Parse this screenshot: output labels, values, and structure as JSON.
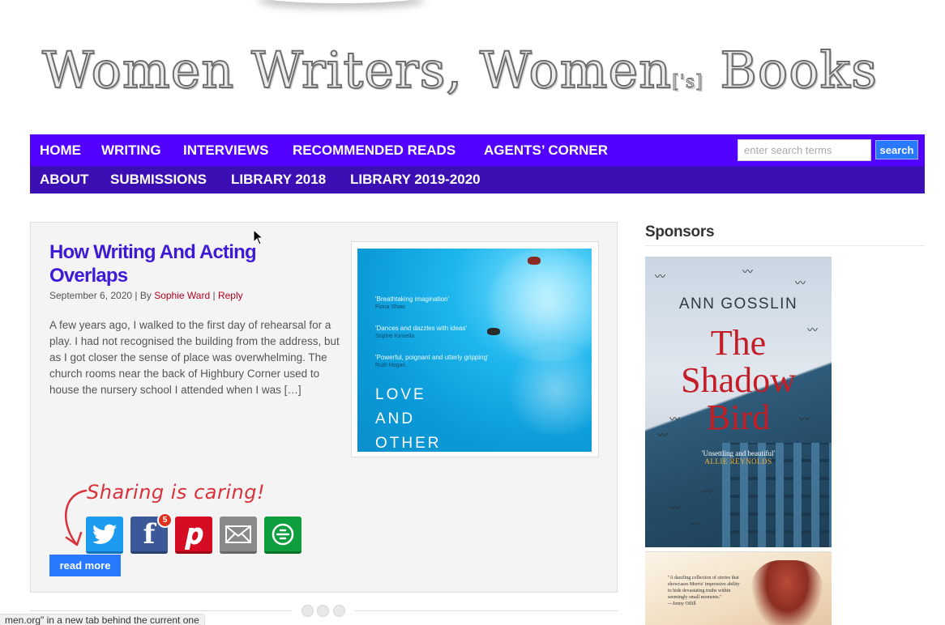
{
  "site": {
    "title_main": "Women Writers, Women",
    "title_sub": "['s]",
    "title_end": " Books"
  },
  "nav": {
    "row1": [
      "HOME",
      "WRITING",
      "INTERVIEWS",
      "RECOMMENDED READS",
      "AGENTS’ CORNER"
    ],
    "row2": [
      "ABOUT",
      "SUBMISSIONS",
      "LIBRARY 2018",
      "LIBRARY 2019-2020"
    ],
    "search_placeholder": "enter search terms",
    "search_button": "search"
  },
  "post": {
    "title": "How Writing And Acting Overlaps",
    "date": "September 6, 2020",
    "by_label": " | By ",
    "author": "Sophie Ward",
    "reply_sep": " | ",
    "reply": "Reply",
    "excerpt": "A few years ago, I walked to the first day of rehearsal for a play. I had not recognised the building from the address, but as I got closer the sense of place was overwhelming. The church rooms near the back of Highbury Corner used to house the nursery school I attended when I was […]",
    "read_more": "read more",
    "thumbnail": {
      "quotes": [
        {
          "text": "'Breathtaking imagination'",
          "source": "Fiona Shaw"
        },
        {
          "text": "'Dances and dazzles with ideas'",
          "source": "Sophie Kinsella"
        },
        {
          "text": "'Powerful, poignant and utterly gripping'",
          "source": "Ruth Hogan"
        }
      ],
      "words": [
        "LOVE",
        "AND",
        "OTHER"
      ]
    }
  },
  "share": {
    "heading": "Sharing is caring!",
    "facebook_count": "5",
    "icons": [
      "twitter-icon",
      "facebook-icon",
      "pinterest-icon",
      "email-icon",
      "share-more-icon"
    ],
    "colors": {
      "twitter": "#1d9bf0",
      "facebook": "#3b5998",
      "pinterest": "#d50c22",
      "email": "#8a8a8a",
      "more": "#0f9e3e"
    }
  },
  "sidebar": {
    "title": "Sponsors",
    "ad1": {
      "author": "ANN GOSSLIN",
      "book_title_line1": "The",
      "book_title_line2": "Shadow",
      "book_title_line3": "Bird",
      "blurb": "'Unsettling and beautiful'",
      "blurb_source": "ALLIE REYNOLDS"
    },
    "ad2": {
      "blurb": "\"A dazzling collection of stories that showcases Morris' impressive ability to hide devastating truths within seemingly small moments.\"",
      "blurb_source": "—Jenny Offill"
    }
  },
  "status_bar": "men.org\" in a new tab behind the current one",
  "colors": {
    "nav_primary": "#5200ff",
    "nav_secondary": "#3b0fb3",
    "accent_button": "#2979ff",
    "post_title": "#3d1bd6",
    "link": "#b3001b"
  }
}
